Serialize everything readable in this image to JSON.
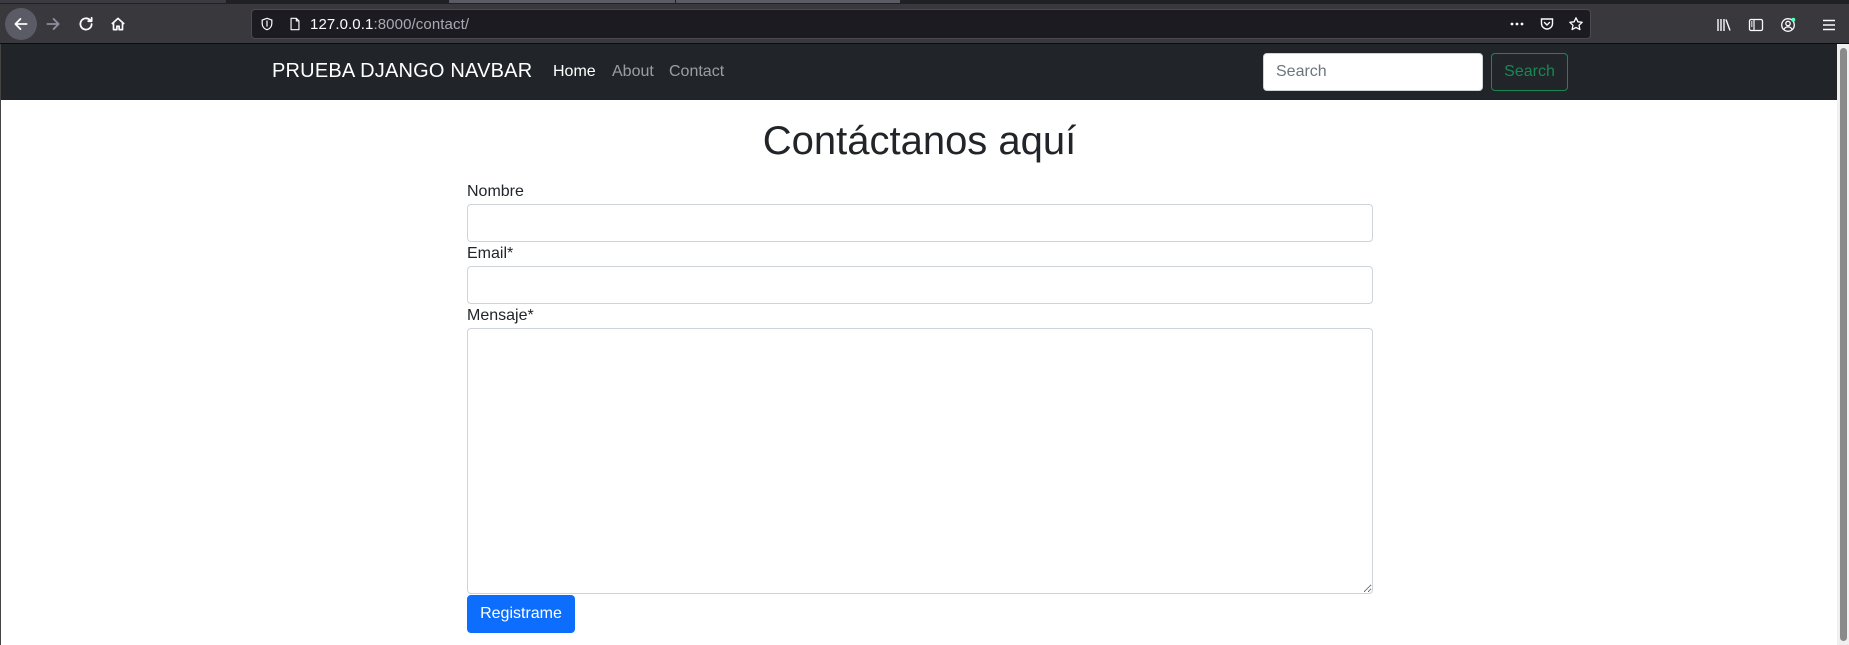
{
  "browser": {
    "url_host": "127.0.0.1",
    "url_path": ":8000/contact/"
  },
  "navbar": {
    "brand": "PRUEBA DJANGO NAVBAR",
    "links": [
      {
        "label": "Home"
      },
      {
        "label": "About"
      },
      {
        "label": "Contact"
      }
    ],
    "search": {
      "placeholder": "Search",
      "value": "",
      "button_label": "Search"
    }
  },
  "form": {
    "title": "Contáctanos aquí",
    "fields": [
      {
        "label": "Nombre",
        "value": ""
      },
      {
        "label": "Email*",
        "value": ""
      },
      {
        "label": "Mensaje*",
        "value": ""
      }
    ],
    "submit_label": "Registrame"
  },
  "colors": {
    "navbar_bg": "#212529",
    "search_outline": "#198754",
    "primary": "#0d6efd"
  },
  "icons": {
    "back": "arrow-left-icon",
    "forward": "arrow-right-icon",
    "reload": "reload-icon",
    "home": "home-icon",
    "tracking": "shield-icon",
    "page": "page-icon",
    "more": "more-icon",
    "pocket": "pocket-icon",
    "bookmark": "star-icon",
    "library": "library-icon",
    "sidebar": "sidebar-icon",
    "account": "account-icon",
    "menu": "hamburger-menu-icon"
  }
}
